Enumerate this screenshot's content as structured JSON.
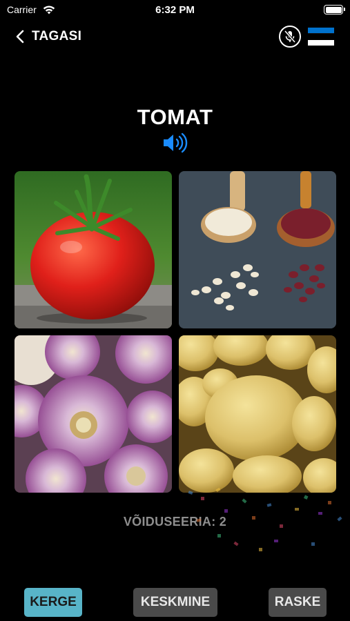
{
  "status_bar": {
    "carrier": "Carrier",
    "time": "6:32 PM"
  },
  "nav": {
    "back_label": "TAGASI",
    "mic_icon": "mic-off-icon",
    "language_flag": {
      "name": "estonian-flag-icon",
      "colors": [
        "#0072ce",
        "#000000",
        "#ffffff"
      ]
    }
  },
  "word": {
    "text": "TOMAT",
    "speaker_icon": "speaker-icon",
    "accent": "#1a8cff"
  },
  "choices": [
    {
      "icon": "tomato-image"
    },
    {
      "icon": "beans-image"
    },
    {
      "icon": "turnip-image"
    },
    {
      "icon": "potato-image"
    }
  ],
  "streak_text": "VÕIDUSEERIA: 2",
  "difficulty": {
    "easy": "KERGE",
    "medium": "KESKMINE",
    "hard": "RASKE",
    "selected": "KERGE",
    "selected_color": "#58b4c8"
  }
}
